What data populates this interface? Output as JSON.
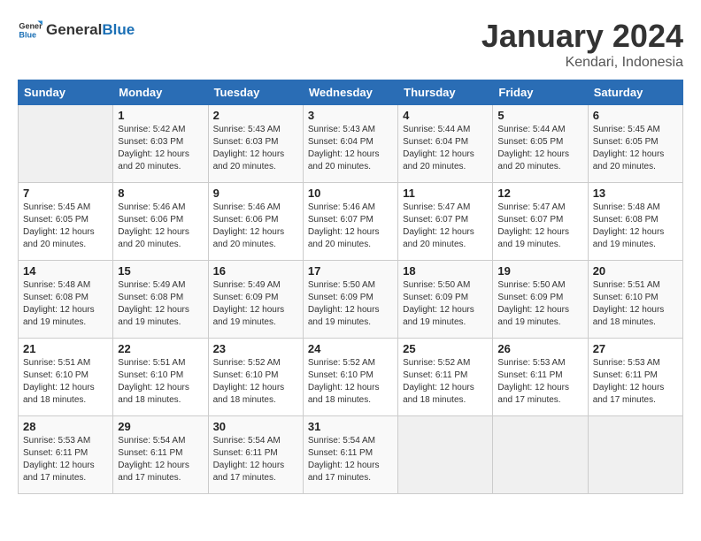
{
  "logo": {
    "text_general": "General",
    "text_blue": "Blue"
  },
  "title": "January 2024",
  "subtitle": "Kendari, Indonesia",
  "headers": [
    "Sunday",
    "Monday",
    "Tuesday",
    "Wednesday",
    "Thursday",
    "Friday",
    "Saturday"
  ],
  "weeks": [
    [
      {
        "day": "",
        "info": ""
      },
      {
        "day": "1",
        "info": "Sunrise: 5:42 AM\nSunset: 6:03 PM\nDaylight: 12 hours\nand 20 minutes."
      },
      {
        "day": "2",
        "info": "Sunrise: 5:43 AM\nSunset: 6:03 PM\nDaylight: 12 hours\nand 20 minutes."
      },
      {
        "day": "3",
        "info": "Sunrise: 5:43 AM\nSunset: 6:04 PM\nDaylight: 12 hours\nand 20 minutes."
      },
      {
        "day": "4",
        "info": "Sunrise: 5:44 AM\nSunset: 6:04 PM\nDaylight: 12 hours\nand 20 minutes."
      },
      {
        "day": "5",
        "info": "Sunrise: 5:44 AM\nSunset: 6:05 PM\nDaylight: 12 hours\nand 20 minutes."
      },
      {
        "day": "6",
        "info": "Sunrise: 5:45 AM\nSunset: 6:05 PM\nDaylight: 12 hours\nand 20 minutes."
      }
    ],
    [
      {
        "day": "7",
        "info": "Sunrise: 5:45 AM\nSunset: 6:05 PM\nDaylight: 12 hours\nand 20 minutes."
      },
      {
        "day": "8",
        "info": "Sunrise: 5:46 AM\nSunset: 6:06 PM\nDaylight: 12 hours\nand 20 minutes."
      },
      {
        "day": "9",
        "info": "Sunrise: 5:46 AM\nSunset: 6:06 PM\nDaylight: 12 hours\nand 20 minutes."
      },
      {
        "day": "10",
        "info": "Sunrise: 5:46 AM\nSunset: 6:07 PM\nDaylight: 12 hours\nand 20 minutes."
      },
      {
        "day": "11",
        "info": "Sunrise: 5:47 AM\nSunset: 6:07 PM\nDaylight: 12 hours\nand 20 minutes."
      },
      {
        "day": "12",
        "info": "Sunrise: 5:47 AM\nSunset: 6:07 PM\nDaylight: 12 hours\nand 19 minutes."
      },
      {
        "day": "13",
        "info": "Sunrise: 5:48 AM\nSunset: 6:08 PM\nDaylight: 12 hours\nand 19 minutes."
      }
    ],
    [
      {
        "day": "14",
        "info": "Sunrise: 5:48 AM\nSunset: 6:08 PM\nDaylight: 12 hours\nand 19 minutes."
      },
      {
        "day": "15",
        "info": "Sunrise: 5:49 AM\nSunset: 6:08 PM\nDaylight: 12 hours\nand 19 minutes."
      },
      {
        "day": "16",
        "info": "Sunrise: 5:49 AM\nSunset: 6:09 PM\nDaylight: 12 hours\nand 19 minutes."
      },
      {
        "day": "17",
        "info": "Sunrise: 5:50 AM\nSunset: 6:09 PM\nDaylight: 12 hours\nand 19 minutes."
      },
      {
        "day": "18",
        "info": "Sunrise: 5:50 AM\nSunset: 6:09 PM\nDaylight: 12 hours\nand 19 minutes."
      },
      {
        "day": "19",
        "info": "Sunrise: 5:50 AM\nSunset: 6:09 PM\nDaylight: 12 hours\nand 19 minutes."
      },
      {
        "day": "20",
        "info": "Sunrise: 5:51 AM\nSunset: 6:10 PM\nDaylight: 12 hours\nand 18 minutes."
      }
    ],
    [
      {
        "day": "21",
        "info": "Sunrise: 5:51 AM\nSunset: 6:10 PM\nDaylight: 12 hours\nand 18 minutes."
      },
      {
        "day": "22",
        "info": "Sunrise: 5:51 AM\nSunset: 6:10 PM\nDaylight: 12 hours\nand 18 minutes."
      },
      {
        "day": "23",
        "info": "Sunrise: 5:52 AM\nSunset: 6:10 PM\nDaylight: 12 hours\nand 18 minutes."
      },
      {
        "day": "24",
        "info": "Sunrise: 5:52 AM\nSunset: 6:10 PM\nDaylight: 12 hours\nand 18 minutes."
      },
      {
        "day": "25",
        "info": "Sunrise: 5:52 AM\nSunset: 6:11 PM\nDaylight: 12 hours\nand 18 minutes."
      },
      {
        "day": "26",
        "info": "Sunrise: 5:53 AM\nSunset: 6:11 PM\nDaylight: 12 hours\nand 17 minutes."
      },
      {
        "day": "27",
        "info": "Sunrise: 5:53 AM\nSunset: 6:11 PM\nDaylight: 12 hours\nand 17 minutes."
      }
    ],
    [
      {
        "day": "28",
        "info": "Sunrise: 5:53 AM\nSunset: 6:11 PM\nDaylight: 12 hours\nand 17 minutes."
      },
      {
        "day": "29",
        "info": "Sunrise: 5:54 AM\nSunset: 6:11 PM\nDaylight: 12 hours\nand 17 minutes."
      },
      {
        "day": "30",
        "info": "Sunrise: 5:54 AM\nSunset: 6:11 PM\nDaylight: 12 hours\nand 17 minutes."
      },
      {
        "day": "31",
        "info": "Sunrise: 5:54 AM\nSunset: 6:11 PM\nDaylight: 12 hours\nand 17 minutes."
      },
      {
        "day": "",
        "info": ""
      },
      {
        "day": "",
        "info": ""
      },
      {
        "day": "",
        "info": ""
      }
    ]
  ]
}
